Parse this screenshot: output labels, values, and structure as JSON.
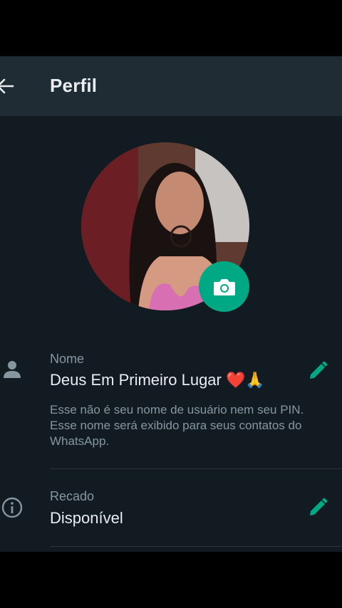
{
  "appbar": {
    "title": "Perfil"
  },
  "profile": {
    "name": {
      "label": "Nome",
      "value": "Deus Em Primeiro Lugar ❤️🙏",
      "help": "Esse não é seu nome de usuário nem seu PIN. Esse nome será exibido para seus contatos do WhatsApp."
    },
    "about": {
      "label": "Recado",
      "value": "Disponível"
    }
  },
  "icons": {
    "back": "arrow-back-icon",
    "camera": "camera-icon",
    "person": "person-icon",
    "info": "info-icon",
    "edit": "pencil-icon"
  },
  "colors": {
    "accent": "#00a884",
    "background": "#121b22",
    "appbar": "#1f2c34",
    "primary_text": "#e9edef",
    "secondary_text": "#8696a0"
  }
}
